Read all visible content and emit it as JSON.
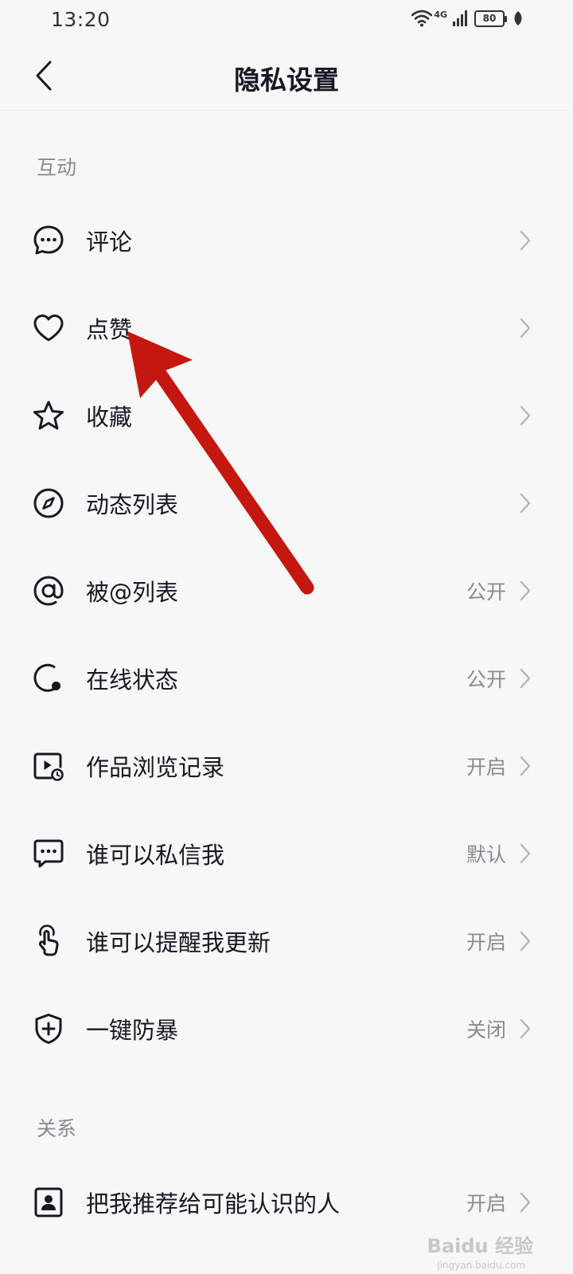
{
  "status_bar": {
    "time": "13:20",
    "network": "4G",
    "battery": "80"
  },
  "nav": {
    "title": "隐私设置"
  },
  "sections": {
    "interaction": "互动",
    "relation": "关系"
  },
  "rows": [
    {
      "label": "评论",
      "value": "",
      "icon": "comment-icon"
    },
    {
      "label": "点赞",
      "value": "",
      "icon": "heart-icon"
    },
    {
      "label": "收藏",
      "value": "",
      "icon": "star-icon"
    },
    {
      "label": "动态列表",
      "value": "",
      "icon": "compass-icon"
    },
    {
      "label": "被@列表",
      "value": "公开",
      "icon": "at-icon"
    },
    {
      "label": "在线状态",
      "value": "公开",
      "icon": "online-status-icon"
    },
    {
      "label": "作品浏览记录",
      "value": "开启",
      "icon": "video-history-icon"
    },
    {
      "label": "谁可以私信我",
      "value": "默认",
      "icon": "message-icon"
    },
    {
      "label": "谁可以提醒我更新",
      "value": "开启",
      "icon": "finger-tap-icon"
    },
    {
      "label": "一键防暴",
      "value": "关闭",
      "icon": "shield-plus-icon"
    },
    {
      "label": "把我推荐给可能认识的人",
      "value": "开启",
      "icon": "contact-card-icon"
    }
  ],
  "annotation": {
    "icon": "red-arrow-pointer"
  },
  "watermark": {
    "text": "Baidu 经验",
    "sub": "jingyan.baidu.com"
  },
  "colors": {
    "arrow": "#c4170f",
    "text_primary": "#161823",
    "text_secondary": "#8a8b91",
    "background": "#f7f7f7"
  }
}
